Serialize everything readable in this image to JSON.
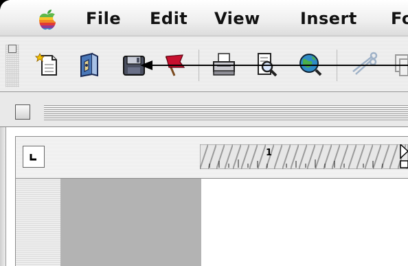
{
  "menubar": {
    "items": [
      {
        "label": "File"
      },
      {
        "label": "Edit"
      },
      {
        "label": "View"
      },
      {
        "label": "Insert"
      },
      {
        "label": "Fo"
      }
    ]
  },
  "toolbar": {
    "buttons": [
      {
        "icon": "new-document-icon"
      },
      {
        "icon": "open-folder-icon"
      },
      {
        "icon": "save-disk-icon"
      },
      {
        "icon": "flag-icon"
      },
      {
        "icon": "print-icon"
      },
      {
        "icon": "print-preview-icon"
      },
      {
        "icon": "web-globe-icon"
      },
      {
        "icon": "cut-scissors-icon"
      }
    ]
  },
  "ruler": {
    "tab_marker": "L",
    "marks": [
      "1"
    ]
  }
}
